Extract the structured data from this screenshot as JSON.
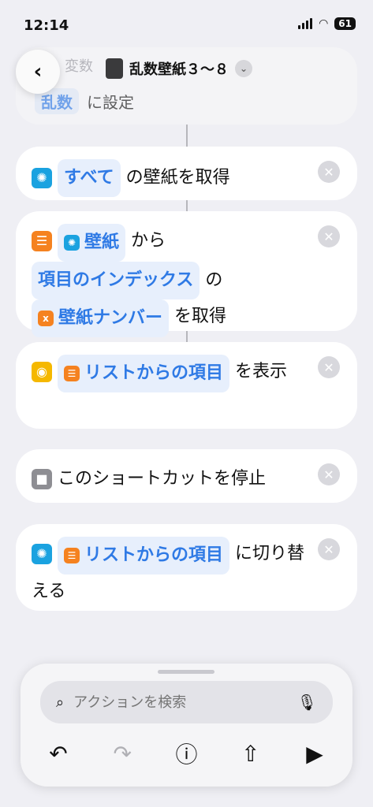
{
  "status": {
    "time": "12:14",
    "battery": "61"
  },
  "nav": {
    "title": "乱数壁紙３～８"
  },
  "top_action": {
    "faded_text": "変数",
    "line2_token": "乱数",
    "line2_text": "に設定"
  },
  "actions": [
    {
      "token": "すべて",
      "text": "の壁紙を取得"
    },
    {
      "token_a": "壁紙",
      "text_a": "から",
      "token_b": "項目のインデックス",
      "text_b": "の",
      "token_c": "壁紙ナンバー",
      "text_c": "を取得"
    },
    {
      "token": "リストからの項目",
      "text": "を表示"
    },
    {
      "text": "このショートカットを停止"
    },
    {
      "token": "リストからの項目",
      "text": "に切り替える"
    }
  ],
  "search": {
    "placeholder": "アクションを検索"
  },
  "toolbar": {
    "undo": "↶",
    "redo": "↷",
    "info": "ⓘ",
    "share": "⇧",
    "run": "▶"
  },
  "colors": {
    "accent": "#2f7ae5",
    "teal": "#1aa2e0",
    "orange": "#f58220",
    "yellow": "#f5b800"
  }
}
